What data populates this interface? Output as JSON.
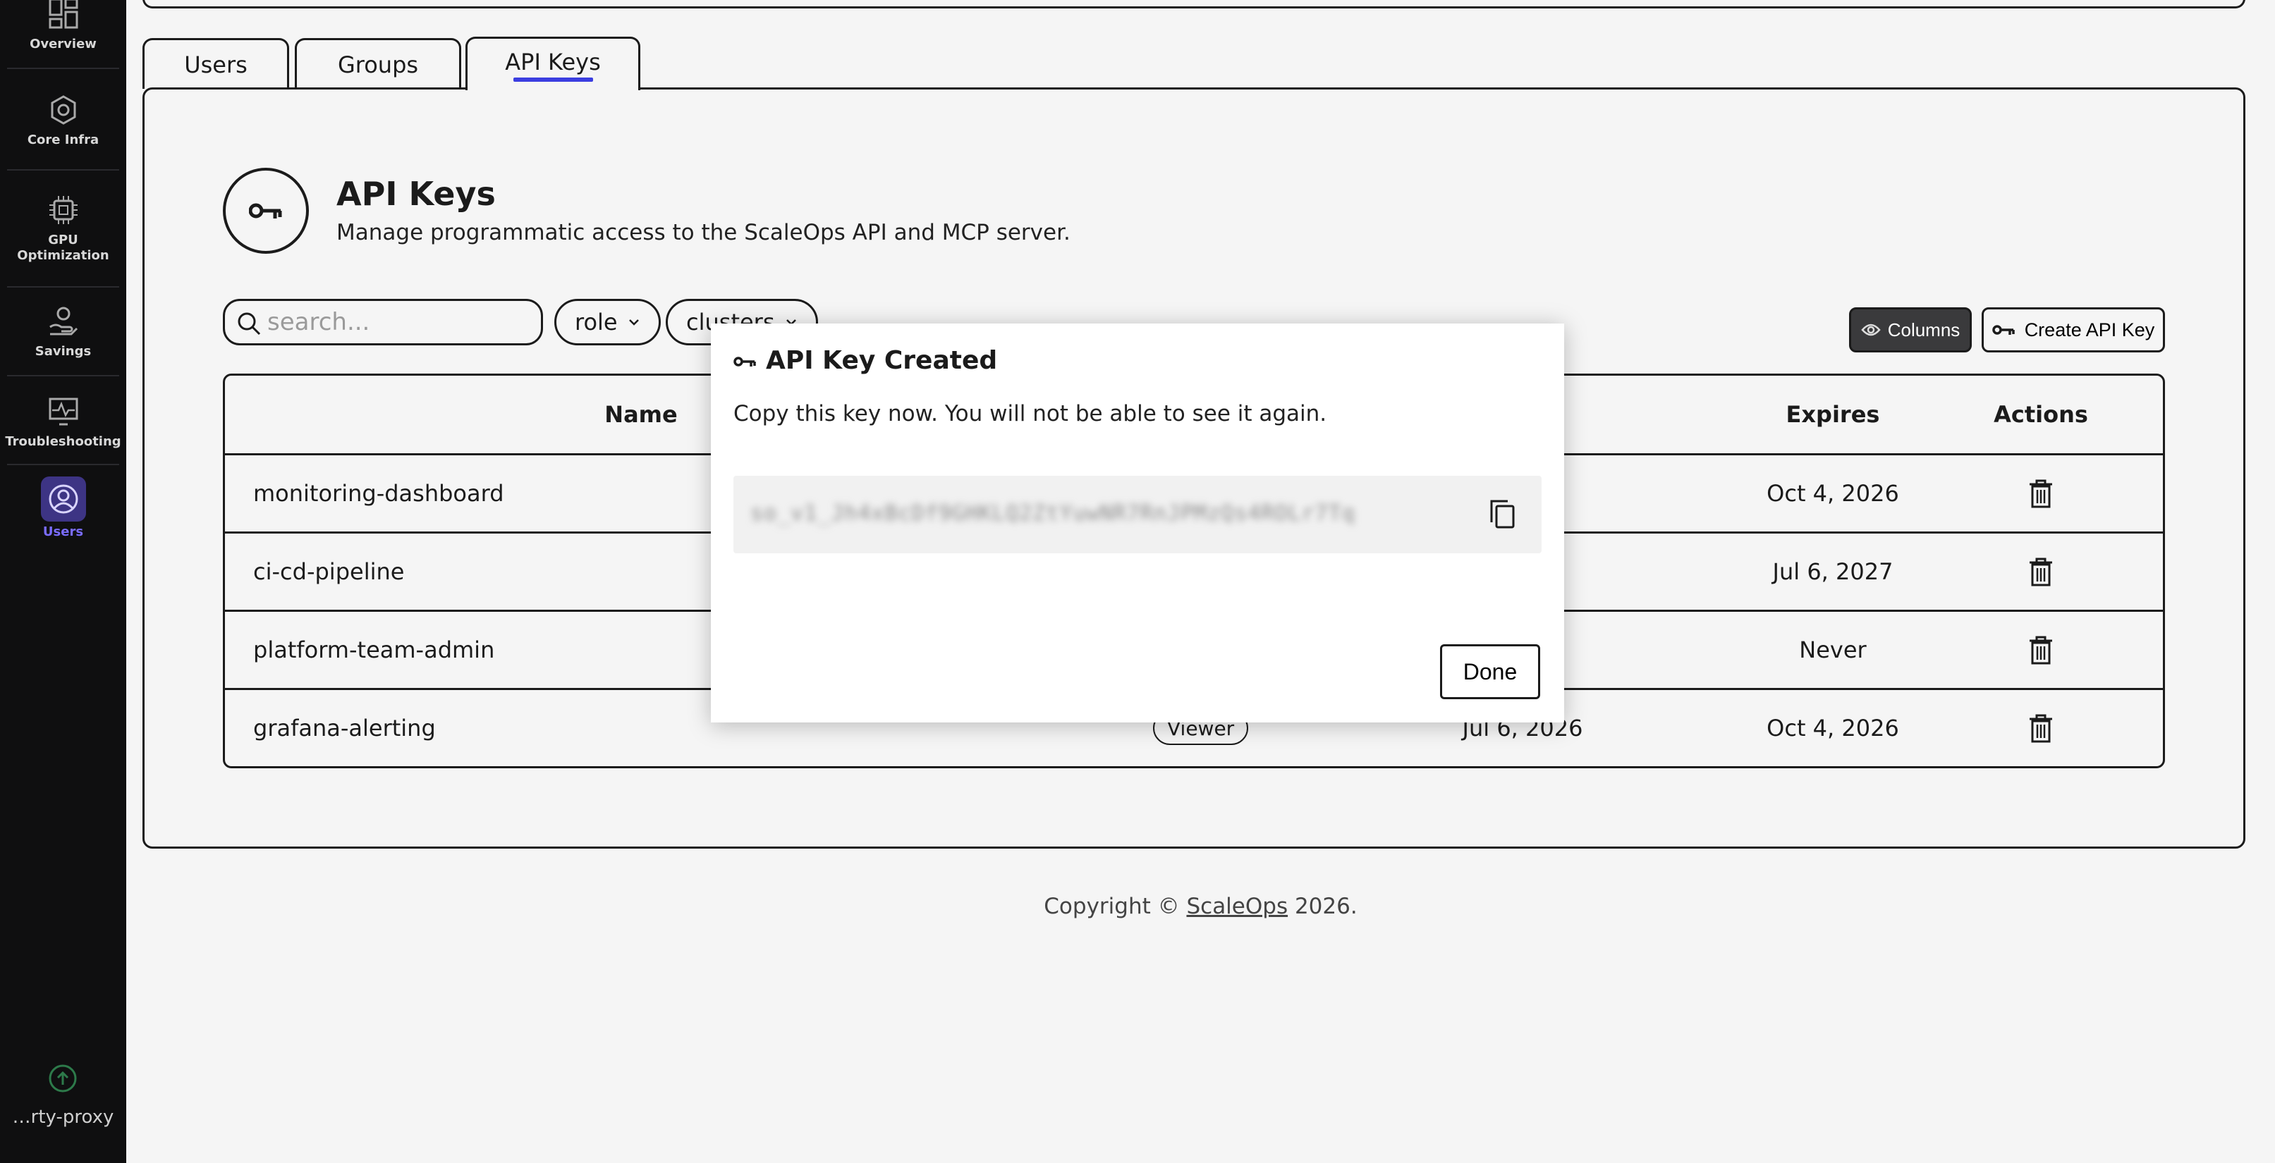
{
  "sidebar": {
    "items": [
      {
        "label": "Overview",
        "icon": "overview-icon"
      },
      {
        "label": "Core Infra",
        "icon": "core-infra-icon"
      },
      {
        "label": "GPU\nOptimization",
        "label_line1": "GPU",
        "label_line2": "Optimization",
        "icon": "gpu-icon"
      },
      {
        "label": "Savings",
        "icon": "savings-icon"
      },
      {
        "label": "Troubleshooting",
        "icon": "troubleshooting-icon"
      },
      {
        "label": "Users",
        "icon": "users-icon",
        "active": true
      }
    ],
    "cluster_label": "…rty-proxy"
  },
  "tabs": [
    {
      "label": "Users"
    },
    {
      "label": "Groups"
    },
    {
      "label": "API Keys",
      "active": true
    }
  ],
  "header": {
    "title": "API Keys",
    "subtitle": "Manage programmatic access to the ScaleOps API and MCP server."
  },
  "filters": {
    "search_placeholder": "search...",
    "role_label": "role",
    "clusters_label": "clusters"
  },
  "toolbar": {
    "columns_label": "Columns",
    "create_label": "Create API Key"
  },
  "table": {
    "headers": {
      "name": "Name",
      "expires": "Expires",
      "actions": "Actions"
    },
    "rows": [
      {
        "name": "monitoring-dashboard",
        "expires": "Oct 4, 2026"
      },
      {
        "name": "ci-cd-pipeline",
        "expires": "Jul 6, 2027"
      },
      {
        "name": "platform-team-admin",
        "expires": "Never"
      },
      {
        "name": "grafana-alerting",
        "role": "Viewer",
        "created": "Jul 6, 2026",
        "expires": "Oct 4, 2026"
      }
    ]
  },
  "footer": {
    "prefix": "Copyright © ",
    "link": "ScaleOps",
    "suffix": " 2026."
  },
  "modal": {
    "title": "API Key Created",
    "message": "Copy this key now. You will not be able to see it again.",
    "key_value": "so_v1_Jh4xBcDf9GHKLQ2ZtYuwNR7RnJPMzQs4ROLr7Tq",
    "done_label": "Done"
  },
  "colors": {
    "sidebar_bg": "#0f0f10",
    "accent": "#3b3ee0",
    "active_nav": "#7a6cff",
    "text": "#1b1b1b"
  }
}
